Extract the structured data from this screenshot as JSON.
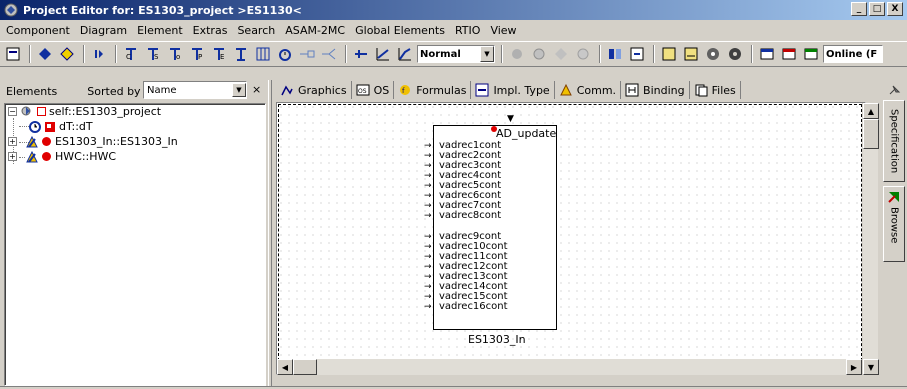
{
  "window": {
    "title": "Project Editor for: ES1303_project >ES1130<",
    "minimize": "_",
    "maximize": "□",
    "close": "X"
  },
  "menu": [
    "Component",
    "Diagram",
    "Element",
    "Extras",
    "Search",
    "ASAM-2MC",
    "Global Elements",
    "RTIO",
    "View"
  ],
  "toolbar": {
    "mode_select": "Normal",
    "online_select": "Online (F"
  },
  "left_panel": {
    "title": "Elements",
    "sorted_by_label": "Sorted by",
    "sort_value": "Name",
    "close": "×"
  },
  "tree": [
    {
      "label": "self::ES1303_project",
      "icon": "project-icon",
      "expander": "−"
    },
    {
      "label": "dT::dT",
      "icon": "clock-icon"
    },
    {
      "label": "ES1303_In::ES1303_In",
      "icon": "module-icon",
      "expander": "+"
    },
    {
      "label": "HWC::HWC",
      "icon": "module-icon",
      "expander": "+"
    }
  ],
  "tabs": [
    {
      "label": "Graphics",
      "icon": "graphics-icon"
    },
    {
      "label": "OS",
      "icon": "os-icon"
    },
    {
      "label": "Formulas",
      "icon": "formulas-icon"
    },
    {
      "label": "Impl. Type",
      "icon": "impl-type-icon"
    },
    {
      "label": "Comm.",
      "icon": "comm-icon"
    },
    {
      "label": "Binding",
      "icon": "binding-icon"
    },
    {
      "label": "Files",
      "icon": "files-icon"
    }
  ],
  "component": {
    "trigger": "AD_update",
    "name": "ES1303_In",
    "ports_group1": [
      "vadrec1cont",
      "vadrec2cont",
      "vadrec3cont",
      "vadrec4cont",
      "vadrec5cont",
      "vadrec6cont",
      "vadrec7cont",
      "vadrec8cont"
    ],
    "ports_group2": [
      "vadrec9cont",
      "vadrec10cont",
      "vadrec11cont",
      "vadrec12cont",
      "vadrec13cont",
      "vadrec14cont",
      "vadrec15cont",
      "vadrec16cont"
    ]
  },
  "side_tabs": {
    "specification": "Specification",
    "browse": "Browse"
  },
  "colors": {
    "title_start": "#0a246a",
    "title_end": "#a6caf0",
    "error_red": "#e00000"
  }
}
